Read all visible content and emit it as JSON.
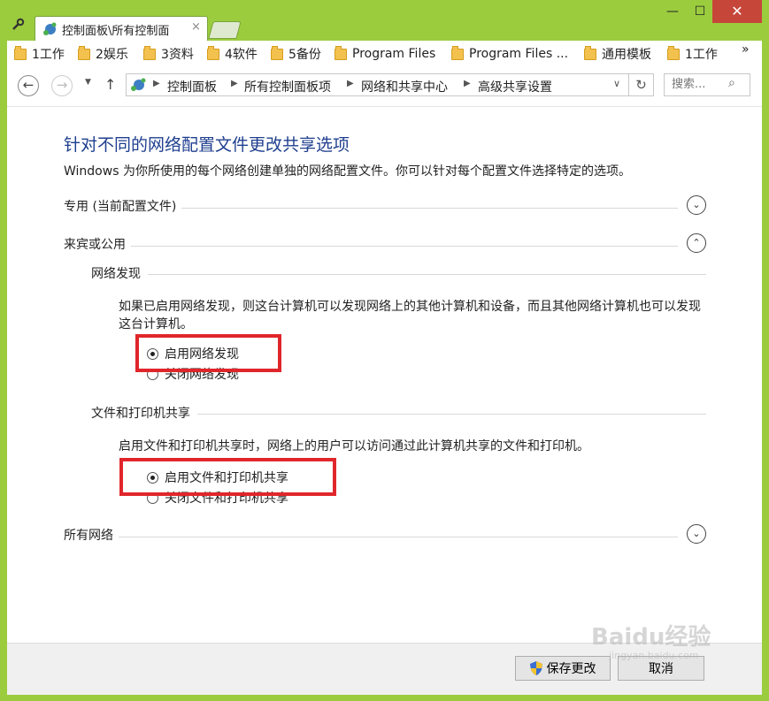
{
  "window": {
    "tab_title": "控制面板\\所有控制面",
    "tab_close": "×",
    "min_label": "—",
    "max_label": "☐",
    "close_label": "✕"
  },
  "bookmarks": {
    "items": [
      "1工作",
      "2娱乐",
      "3资料",
      "4软件",
      "5备份",
      "Program Files",
      "Program Files ...",
      "通用模板",
      "1工作"
    ],
    "more": "»"
  },
  "nav": {
    "back": "←",
    "forward": "→",
    "dropdown": "▼",
    "up": "↑",
    "breadcrumbs": [
      "控制面板",
      "所有控制面板项",
      "网络和共享中心",
      "高级共享设置"
    ],
    "addr_dropdown": "∨",
    "refresh": "↻",
    "search_placeholder": "搜索...",
    "search_icon": "⌕"
  },
  "content": {
    "title": "针对不同的网络配置文件更改共享选项",
    "description": "Windows 为你所使用的每个网络创建单独的网络配置文件。你可以针对每个配置文件选择特定的选项。",
    "sections": {
      "private": {
        "label": "专用 (当前配置文件)",
        "state": "collapsed"
      },
      "guest": {
        "label": "来宾或公用",
        "state": "expanded"
      },
      "all": {
        "label": "所有网络",
        "state": "collapsed"
      }
    },
    "network_discovery": {
      "heading": "网络发现",
      "text": "如果已启用网络发现，则这台计算机可以发现网络上的其他计算机和设备，而且其他网络计算机也可以发现这台计算机。",
      "option_on": "启用网络发现",
      "option_off": "关闭网络发现",
      "selected": "on"
    },
    "file_sharing": {
      "heading": "文件和打印机共享",
      "text": "启用文件和打印机共享时，网络上的用户可以访问通过此计算机共享的文件和打印机。",
      "option_on": "启用文件和打印机共享",
      "option_off": "关闭文件和打印机共享",
      "selected": "on"
    },
    "expand_icon": "⌄",
    "collapse_icon": "⌃"
  },
  "footer": {
    "save_label": "保存更改",
    "cancel_label": "取消"
  },
  "watermark": {
    "text": "Baidu经验",
    "sub": "jingyan.baidu.com"
  },
  "colors": {
    "frame": "#9bcc3e",
    "title_blue": "#1f3f8f",
    "highlight_red": "#e0262b"
  }
}
